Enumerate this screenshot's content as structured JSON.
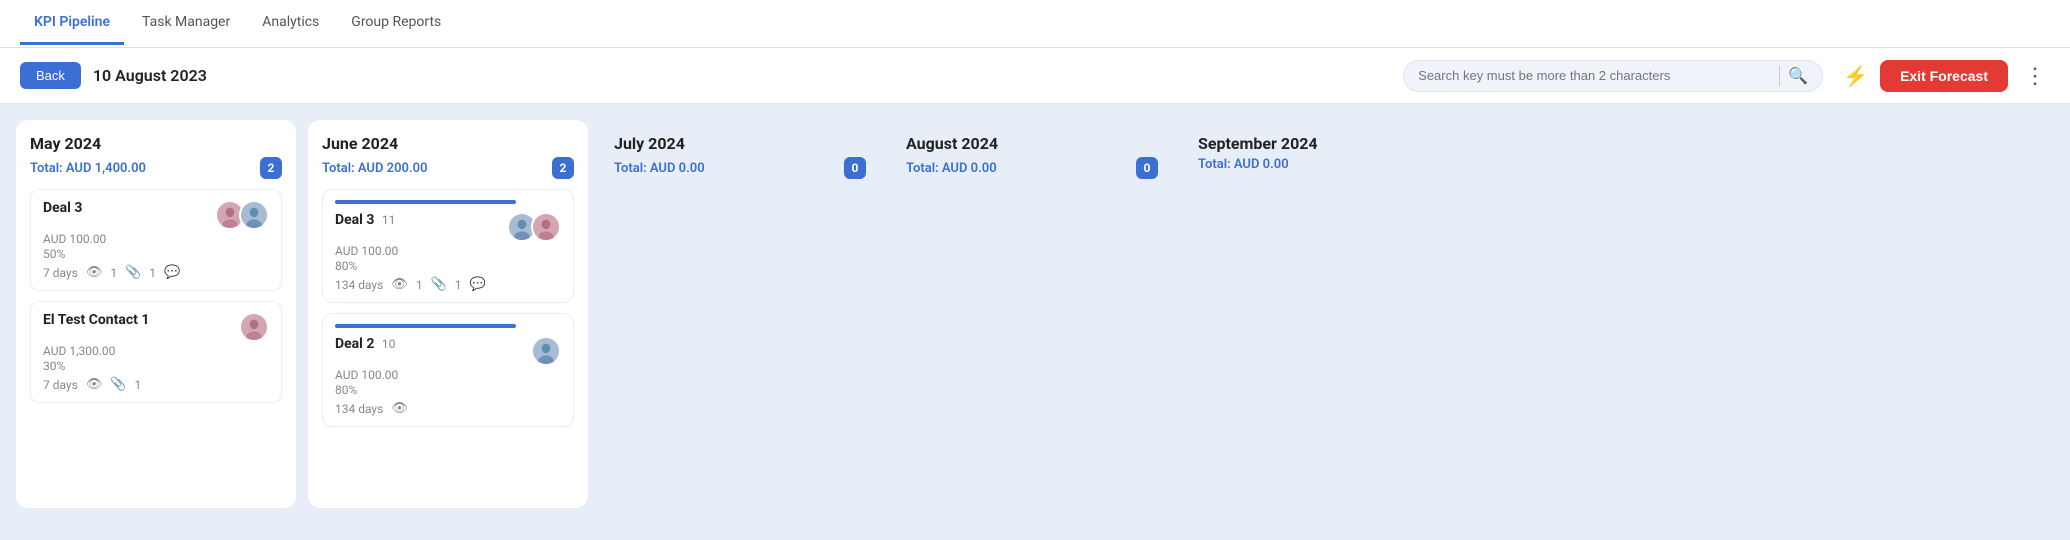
{
  "nav": {
    "tabs": [
      {
        "id": "kpi-pipeline",
        "label": "KPI Pipeline",
        "active": true
      },
      {
        "id": "task-manager",
        "label": "Task Manager",
        "active": false
      },
      {
        "id": "analytics",
        "label": "Analytics",
        "active": false
      },
      {
        "id": "group-reports",
        "label": "Group Reports",
        "active": false
      }
    ]
  },
  "toolbar": {
    "back_label": "Back",
    "date": "10 August 2023",
    "search_placeholder": "Search key must be more than 2 characters",
    "exit_label": "Exit Forecast"
  },
  "columns": [
    {
      "id": "may-2024",
      "title": "May 2024",
      "total": "Total: AUD 1,400.00",
      "badge": "2",
      "show_badge": true,
      "empty": false,
      "deals": [
        {
          "id": "deal3-may",
          "name": "Deal 3",
          "count": "",
          "amount": "AUD 100.00",
          "percent": "50%",
          "days": "7 days",
          "show_progress": false,
          "progress_width": 50,
          "avatars": [
            {
              "type": "female",
              "initials": "F"
            },
            {
              "type": "male",
              "initials": "M"
            }
          ],
          "meta": {
            "eye": true,
            "clip": true,
            "clip_count": "1",
            "eye_count": "1",
            "chat": true
          }
        },
        {
          "id": "el-test-contact1",
          "name": "El Test Contact 1",
          "count": "",
          "amount": "AUD 1,300.00",
          "percent": "30%",
          "days": "7 days",
          "show_progress": false,
          "progress_width": 30,
          "avatars": [
            {
              "type": "female",
              "initials": "F"
            }
          ],
          "meta": {
            "eye": true,
            "clip": true,
            "clip_count": "1",
            "eye_count": "",
            "chat": false
          }
        }
      ]
    },
    {
      "id": "june-2024",
      "title": "June 2024",
      "total": "Total: AUD 200.00",
      "badge": "2",
      "show_badge": true,
      "empty": false,
      "deals": [
        {
          "id": "deal3-june",
          "name": "Deal 3",
          "count": "11",
          "amount": "AUD 100.00",
          "percent": "80%",
          "days": "134 days",
          "show_progress": true,
          "progress_width": 80,
          "avatars": [
            {
              "type": "male",
              "initials": "M"
            },
            {
              "type": "female",
              "initials": "F"
            }
          ],
          "meta": {
            "eye": true,
            "clip": true,
            "clip_count": "1",
            "eye_count": "1",
            "chat": true
          }
        },
        {
          "id": "deal2-june",
          "name": "Deal 2",
          "count": "10",
          "amount": "AUD 100.00",
          "percent": "80%",
          "days": "134 days",
          "show_progress": true,
          "progress_width": 80,
          "avatars": [
            {
              "type": "male",
              "initials": "M"
            }
          ],
          "meta": {
            "eye": true,
            "clip": false,
            "clip_count": "",
            "eye_count": "",
            "chat": false
          }
        }
      ]
    },
    {
      "id": "july-2024",
      "title": "July 2024",
      "total": "Total: AUD 0.00",
      "badge": "0",
      "show_badge": true,
      "empty": true,
      "deals": []
    },
    {
      "id": "august-2024",
      "title": "August 2024",
      "total": "Total: AUD 0.00",
      "badge": "0",
      "show_badge": true,
      "empty": true,
      "deals": []
    },
    {
      "id": "september-2024",
      "title": "September 2024",
      "total": "Total: AUD 0.00",
      "badge": "",
      "show_badge": false,
      "empty": true,
      "deals": []
    }
  ]
}
